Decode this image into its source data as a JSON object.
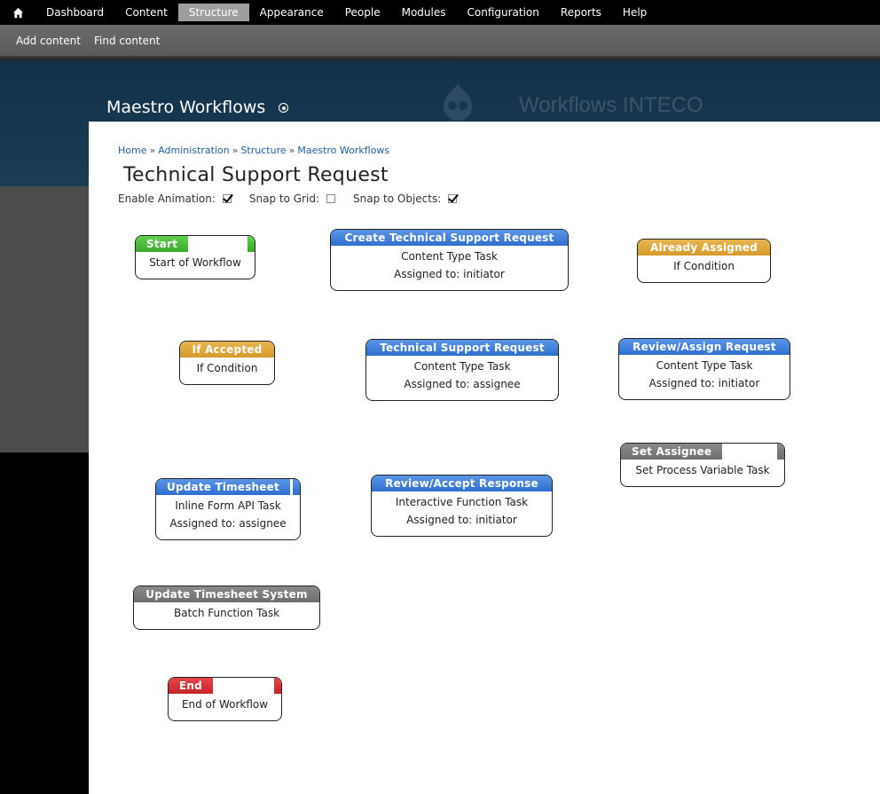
{
  "toolbar": {
    "home_icon": "home-icon",
    "items": [
      "Dashboard",
      "Content",
      "Structure",
      "Appearance",
      "People",
      "Modules",
      "Configuration",
      "Reports",
      "Help"
    ],
    "active": "Structure"
  },
  "shortcuts": [
    "Add content",
    "Find content"
  ],
  "site": {
    "title": "Maestro Workflows",
    "watermark": "Workflows INTECO"
  },
  "breadcrumb": [
    "Home",
    "Administration",
    "Structure",
    "Maestro Workflows"
  ],
  "page_title": "Technical Support Request",
  "options": {
    "animation_label": "Enable Animation:",
    "animation_checked": true,
    "grid_label": "Snap to Grid:",
    "grid_checked": false,
    "objects_label": "Snap to Objects:",
    "objects_checked": true
  },
  "tasks": [
    {
      "title": "Start",
      "lines": [
        "Start of Workflow"
      ],
      "color": "#3aa92b"
    },
    {
      "title": "Create Technical Support Request",
      "lines": [
        "Content Type Task",
        "Assigned to: initiator"
      ],
      "color": "#2f6fcf"
    },
    {
      "title": "Already Assigned",
      "lines": [
        "If Condition"
      ],
      "color": "#d59a2a"
    },
    {
      "title": "If Accepted",
      "lines": [
        "If Condition"
      ],
      "color": "#d59a2a"
    },
    {
      "title": "Technical Support Request",
      "lines": [
        "Content Type Task",
        "Assigned to: assignee"
      ],
      "color": "#2f6fcf"
    },
    {
      "title": "Review/Assign Request",
      "lines": [
        "Content Type Task",
        "Assigned to: initiator"
      ],
      "color": "#2f6fcf"
    },
    {
      "title": "Set Assignee",
      "lines": [
        "Set Process Variable Task"
      ],
      "color": "#6e6e6e"
    },
    {
      "title": "Update Timesheet",
      "lines": [
        "Inline Form API Task",
        "Assigned to: assignee"
      ],
      "color": "#2f6fcf"
    },
    {
      "title": "Review/Accept Response",
      "lines": [
        "Interactive Function Task",
        "Assigned to: initiator"
      ],
      "color": "#2f6fcf"
    },
    {
      "title": "Update Timesheet System",
      "lines": [
        "Batch Function Task"
      ],
      "color": "#6e6e6e"
    },
    {
      "title": "End",
      "lines": [
        "End of Workflow"
      ],
      "color": "#c52427"
    }
  ]
}
